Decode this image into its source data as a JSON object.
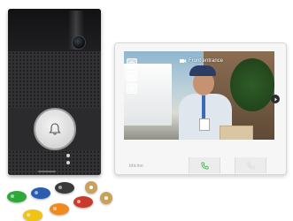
{
  "monitor": {
    "call_banner_text": "Front entrance",
    "brand_label": "bticino",
    "side_icons": [
      "settings-icon",
      "door-key-icon",
      "menu-icon"
    ],
    "hw_buttons": [
      "phone-answer-icon",
      "phone-hangup-icon"
    ]
  },
  "panel": {
    "call_button_icon": "bell-icon",
    "status_leds": 2
  },
  "colors": {
    "panel_body": "#2b2b2d",
    "answer_green": "#3fae4a",
    "tag_colors": [
      "#2fa83a",
      "#2a5db0",
      "#3a3a3a",
      "#c93a2a",
      "#f0c417",
      "#f08a1c"
    ],
    "coin_color": "#c9a15a"
  }
}
